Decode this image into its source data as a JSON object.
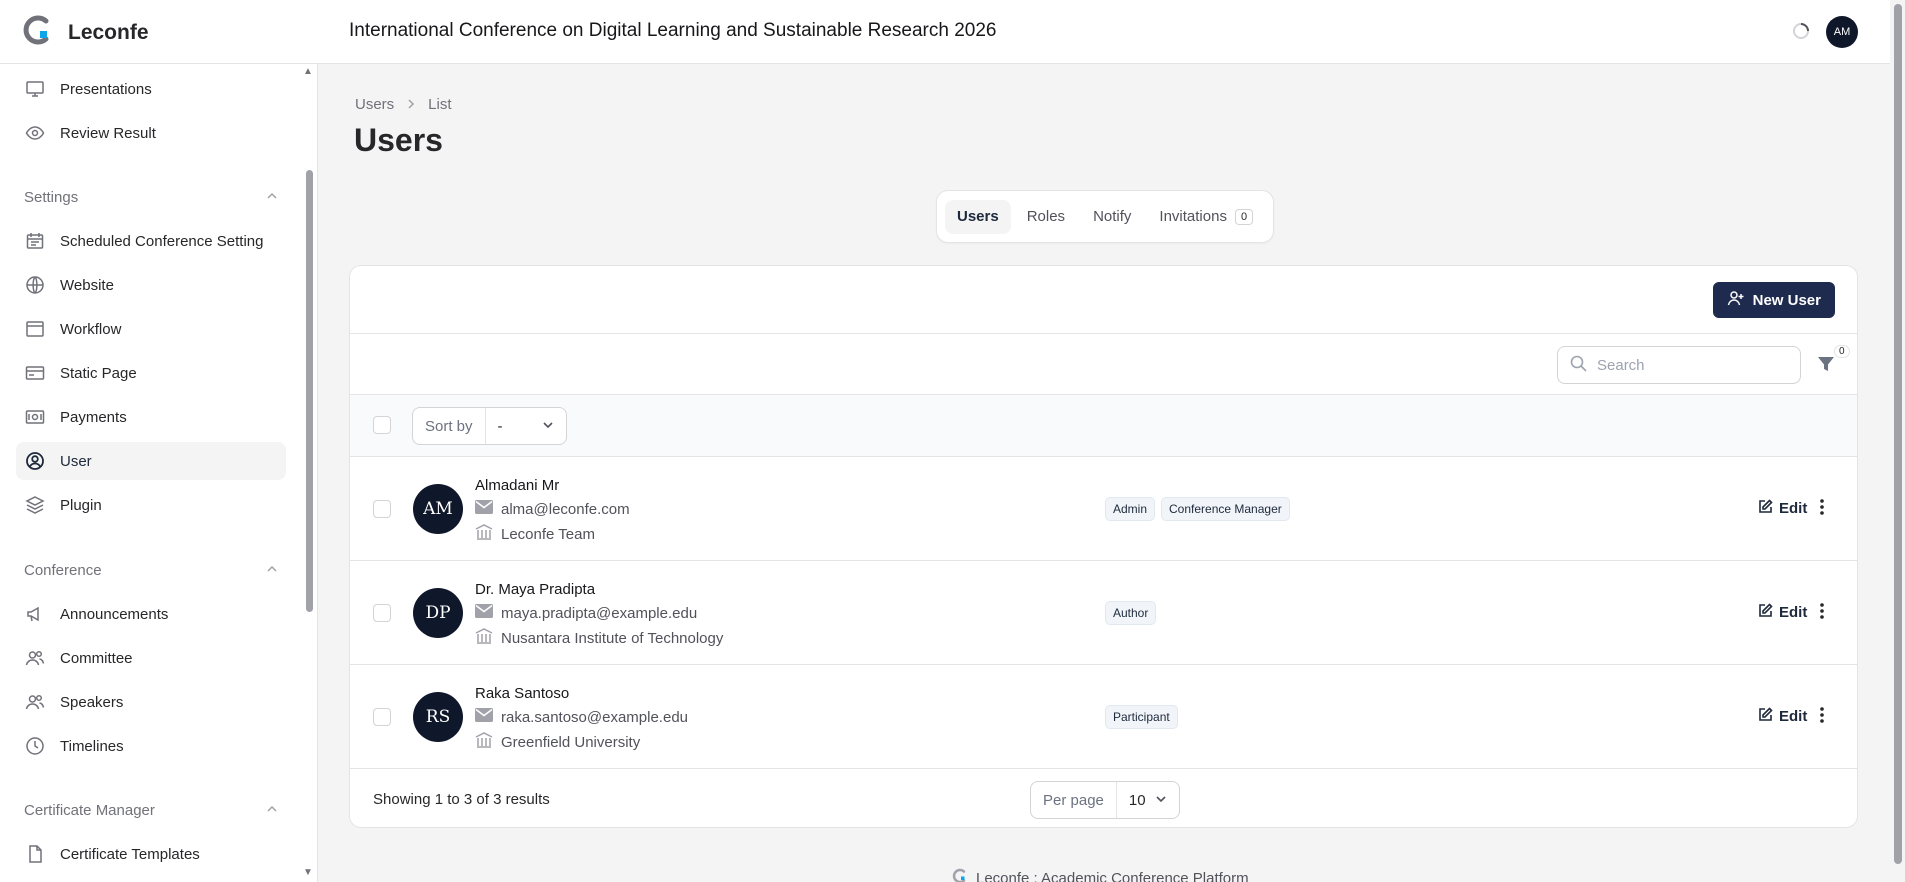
{
  "app": {
    "name": "Leconfe",
    "conference_title": "International Conference on Digital Learning and Sustainable Research 2026",
    "user_initials": "AM"
  },
  "sidebar": {
    "top_items": [
      {
        "label": "Presentations",
        "icon": "monitor-icon"
      },
      {
        "label": "Review Result",
        "icon": "eye-icon"
      }
    ],
    "groups": [
      {
        "label": "Settings",
        "items": [
          {
            "label": "Scheduled Conference Setting",
            "icon": "calendar-icon"
          },
          {
            "label": "Website",
            "icon": "globe-icon"
          },
          {
            "label": "Workflow",
            "icon": "window-icon"
          },
          {
            "label": "Static Page",
            "icon": "card-icon"
          },
          {
            "label": "Payments",
            "icon": "banknote-icon"
          },
          {
            "label": "User",
            "icon": "user-circle-icon",
            "active": true
          },
          {
            "label": "Plugin",
            "icon": "layers-icon"
          }
        ]
      },
      {
        "label": "Conference",
        "items": [
          {
            "label": "Announcements",
            "icon": "megaphone-icon"
          },
          {
            "label": "Committee",
            "icon": "users-icon"
          },
          {
            "label": "Speakers",
            "icon": "users-icon"
          },
          {
            "label": "Timelines",
            "icon": "clock-icon"
          }
        ]
      },
      {
        "label": "Certificate Manager",
        "items": [
          {
            "label": "Certificate Templates",
            "icon": "document-icon"
          }
        ]
      }
    ]
  },
  "breadcrumb": {
    "parent": "Users",
    "current": "List"
  },
  "page": {
    "title": "Users"
  },
  "tabs": [
    {
      "label": "Users",
      "active": true
    },
    {
      "label": "Roles"
    },
    {
      "label": "Notify"
    },
    {
      "label": "Invitations",
      "count": "0"
    }
  ],
  "actions": {
    "new_user": "New User"
  },
  "search": {
    "placeholder": "Search"
  },
  "filter": {
    "count": "0"
  },
  "sort": {
    "label": "Sort by",
    "value": "-"
  },
  "users": [
    {
      "initials": "AM",
      "name": "Almadani Mr",
      "email": "alma@leconfe.com",
      "affiliation": "Leconfe Team",
      "roles": [
        "Admin",
        "Conference Manager"
      ]
    },
    {
      "initials": "DP",
      "name": "Dr. Maya Pradipta",
      "email": "maya.pradipta@example.edu",
      "affiliation": "Nusantara Institute of Technology",
      "roles": [
        "Author"
      ]
    },
    {
      "initials": "RS",
      "name": "Raka Santoso",
      "email": "raka.santoso@example.edu",
      "affiliation": "Greenfield University",
      "roles": [
        "Participant"
      ]
    }
  ],
  "row_actions": {
    "edit": "Edit"
  },
  "pagination": {
    "summary": "Showing 1 to 3 of 3 results",
    "per_page_label": "Per page",
    "per_page_value": "10"
  },
  "footer": {
    "text": "Leconfe : Academic Conference Platform"
  },
  "colors": {
    "primary": "#1e2b4e",
    "avatar_bg": "#0f172a",
    "logo_accent": "#0ea5e9"
  }
}
